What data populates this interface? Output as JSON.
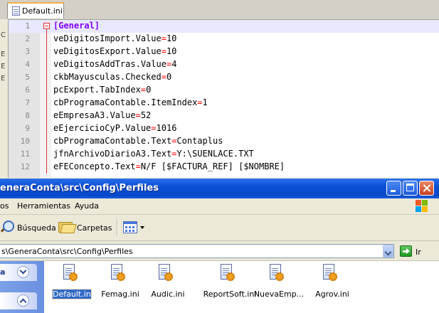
{
  "editor": {
    "tab_label": "Default.ini",
    "lines": [
      {
        "num": "1",
        "parts": [
          {
            "t": "[General]",
            "c": "sec"
          }
        ]
      },
      {
        "num": "2",
        "parts": [
          {
            "t": "veDigitosImport.Value",
            "c": ""
          },
          {
            "t": "=",
            "c": "eq"
          },
          {
            "t": "10",
            "c": ""
          }
        ]
      },
      {
        "num": "3",
        "parts": [
          {
            "t": "veDigitosExport.Value",
            "c": ""
          },
          {
            "t": "=",
            "c": "eq"
          },
          {
            "t": "10",
            "c": ""
          }
        ]
      },
      {
        "num": "4",
        "parts": [
          {
            "t": "veDigitosAddTras.Value",
            "c": ""
          },
          {
            "t": "=",
            "c": "eq"
          },
          {
            "t": "4",
            "c": ""
          }
        ]
      },
      {
        "num": "5",
        "parts": [
          {
            "t": "ckbMayusculas.Checked",
            "c": ""
          },
          {
            "t": "=",
            "c": "eq"
          },
          {
            "t": "0",
            "c": ""
          }
        ]
      },
      {
        "num": "6",
        "parts": [
          {
            "t": "pcExport.TabIndex",
            "c": ""
          },
          {
            "t": "=",
            "c": "eq"
          },
          {
            "t": "0",
            "c": ""
          }
        ]
      },
      {
        "num": "7",
        "parts": [
          {
            "t": "cbProgramaContable.ItemIndex",
            "c": ""
          },
          {
            "t": "=",
            "c": "eq"
          },
          {
            "t": "1",
            "c": ""
          }
        ]
      },
      {
        "num": "8",
        "parts": [
          {
            "t": "eEmpresaA3.Value",
            "c": ""
          },
          {
            "t": "=",
            "c": "eq"
          },
          {
            "t": "52",
            "c": ""
          }
        ]
      },
      {
        "num": "9",
        "parts": [
          {
            "t": "eEjercicioCyP.Value",
            "c": ""
          },
          {
            "t": "=",
            "c": "eq"
          },
          {
            "t": "1016",
            "c": ""
          }
        ]
      },
      {
        "num": "10",
        "parts": [
          {
            "t": "cbProgramaContable.Text",
            "c": ""
          },
          {
            "t": "=",
            "c": "eq"
          },
          {
            "t": "Contaplus",
            "c": ""
          }
        ]
      },
      {
        "num": "11",
        "parts": [
          {
            "t": "jfnArchivoDiarioA3.Text",
            "c": ""
          },
          {
            "t": "=",
            "c": "eq"
          },
          {
            "t": "Y:\\SUENLACE.TXT",
            "c": ""
          }
        ]
      },
      {
        "num": "12",
        "parts": [
          {
            "t": "eFEConcepto.Text",
            "c": ""
          },
          {
            "t": "=",
            "c": "eq"
          },
          {
            "t": "N/F [$FACTURA_REF] [$NOMBRE]",
            "c": ""
          }
        ]
      }
    ],
    "left_strip_marks": [
      "C",
      "E",
      "E",
      "E"
    ],
    "colors": {
      "section": "#8000ff",
      "operator": "#ff0000",
      "current_line": "#e8e8ff"
    }
  },
  "explorer": {
    "title": "eneraConta\\src\\Config\\Perfiles",
    "menu": [
      "os",
      "Herramientas",
      "Ayuda"
    ],
    "toolbar": {
      "search_label": "Búsqueda",
      "folders_label": "Carpetas"
    },
    "address": {
      "value": "s\\GeneraConta\\src\\Config\\Perfiles",
      "go_label": "Ir"
    },
    "task_pane": {
      "first_label": "a"
    },
    "files": [
      {
        "name": "Default.ini",
        "selected": true
      },
      {
        "name": "Femag.ini",
        "selected": false
      },
      {
        "name": "Audic.ini",
        "selected": false
      },
      {
        "name": "ReportSoft.ini",
        "selected": false
      },
      {
        "name": "NuevaEmp...",
        "selected": false
      },
      {
        "name": "Agrov.ini",
        "selected": false
      }
    ],
    "colors": {
      "titlebar": "#0a4fd8",
      "selection": "#316ac5"
    }
  }
}
